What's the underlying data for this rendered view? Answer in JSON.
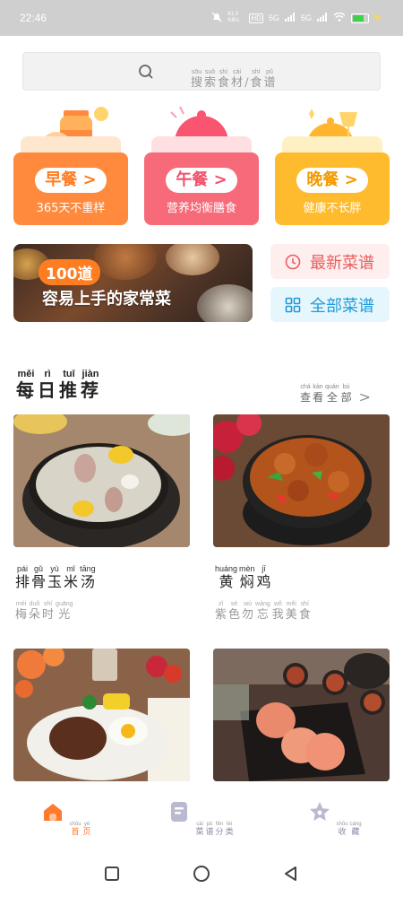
{
  "status_bar": {
    "time": "22:46",
    "net_speed": "81.0 KB/s",
    "hd": "HD",
    "sim1": "5G",
    "sim2": "5G",
    "battery": "84"
  },
  "search": {
    "placeholder_words": [
      {
        "py": "sōu",
        "hz": "搜"
      },
      {
        "py": "suǒ",
        "hz": "索"
      },
      {
        "py": "shí",
        "hz": "食"
      },
      {
        "py": "cái",
        "hz": "材"
      },
      {
        "py": "",
        "hz": "/"
      },
      {
        "py": "shí",
        "hz": "食"
      },
      {
        "py": "pǔ",
        "hz": "谱"
      }
    ]
  },
  "meals": [
    {
      "label": "早餐",
      "arrow": ">",
      "sub": "365天不重样",
      "color": "#ff8a3d",
      "color_top": "#ffe6cf",
      "text_color": "#ff7a1f"
    },
    {
      "label": "午餐",
      "arrow": ">",
      "sub": "营养均衡膳食",
      "color": "#f66a7a",
      "color_top": "#ffdfe2",
      "text_color": "#f0506a"
    },
    {
      "label": "晚餐",
      "arrow": ">",
      "sub": "健康不长胖",
      "color": "#ffbb2e",
      "color_top": "#fff0c4",
      "text_color": "#f29a00"
    }
  ],
  "banner": {
    "badge": "100道",
    "text": "容易上手的家常菜"
  },
  "side_buttons": {
    "newest": "最新菜谱",
    "all": "全部菜谱"
  },
  "section": {
    "title_words": [
      {
        "py": "měi",
        "hz": "每"
      },
      {
        "py": "rì",
        "hz": "日"
      },
      {
        "py": "tuī",
        "hz": "推"
      },
      {
        "py": "jiàn",
        "hz": "荐"
      }
    ],
    "view_all_words": [
      {
        "py": "chá",
        "hz": "查"
      },
      {
        "py": "kàn",
        "hz": "看"
      },
      {
        "py": "quán",
        "hz": "全"
      },
      {
        "py": "bù",
        "hz": "部"
      }
    ],
    "chevron": ">"
  },
  "recipes": [
    {
      "name": [
        {
          "py": "pái",
          "hz": "排"
        },
        {
          "py": "gǔ",
          "hz": "骨"
        },
        {
          "py": "yù",
          "hz": "玉"
        },
        {
          "py": "mǐ",
          "hz": "米"
        },
        {
          "py": "tāng",
          "hz": "汤"
        }
      ],
      "desc": [
        {
          "py": "méi",
          "hz": "梅"
        },
        {
          "py": "duǒ",
          "hz": "朵"
        },
        {
          "py": "shí",
          "hz": "时"
        },
        {
          "py": "guāng",
          "hz": "光"
        }
      ]
    },
    {
      "name": [
        {
          "py": "huáng",
          "hz": "黄"
        },
        {
          "py": "mèn",
          "hz": "焖"
        },
        {
          "py": "jī",
          "hz": "鸡"
        }
      ],
      "desc": [
        {
          "py": "zǐ",
          "hz": "紫"
        },
        {
          "py": "sè",
          "hz": "色"
        },
        {
          "py": "wù",
          "hz": "勿"
        },
        {
          "py": "wàng",
          "hz": "忘"
        },
        {
          "py": "wǒ",
          "hz": "我"
        },
        {
          "py": "měi",
          "hz": "美"
        },
        {
          "py": "shí",
          "hz": "食"
        }
      ]
    },
    {
      "name": [],
      "desc": []
    },
    {
      "name": [],
      "desc": []
    }
  ],
  "tabs": [
    {
      "words": [
        {
          "py": "shǒu",
          "hz": "首"
        },
        {
          "py": "yè",
          "hz": "页"
        }
      ],
      "active": true,
      "color": "#ff7a2e"
    },
    {
      "words": [
        {
          "py": "cài",
          "hz": "菜"
        },
        {
          "py": "pǔ",
          "hz": "谱"
        },
        {
          "py": "fēn",
          "hz": "分"
        },
        {
          "py": "lèi",
          "hz": "类"
        }
      ],
      "active": false,
      "color": "#8a8aa8"
    },
    {
      "words": [
        {
          "py": "shōu",
          "hz": "收"
        },
        {
          "py": "cáng",
          "hz": "藏"
        }
      ],
      "active": false,
      "color": "#8a8aa8"
    }
  ]
}
